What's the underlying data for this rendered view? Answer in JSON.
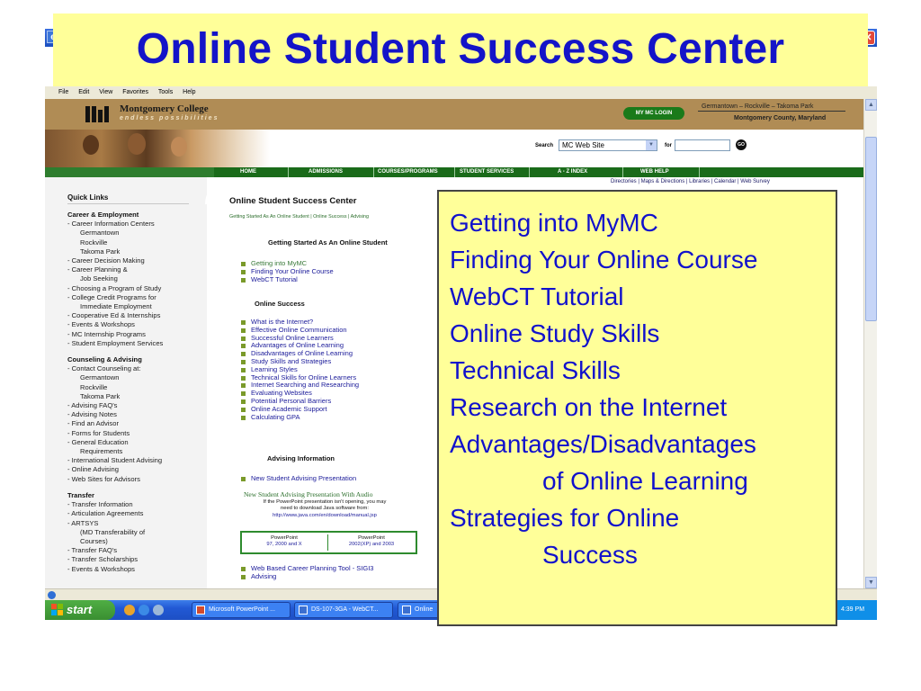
{
  "slide_title": "Online Student Success Center",
  "browser": {
    "menu": [
      "File",
      "Edit",
      "View",
      "Favorites",
      "Tools",
      "Help"
    ]
  },
  "college": {
    "name": "Montgomery College",
    "tagline": "endless possibilities",
    "my_mc_login": "MY MC LOGIN",
    "campuses": "Germantown – Rockville – Takoma Park",
    "county": "Montgomery County, Maryland",
    "search_label": "Search",
    "search_scope": "MC Web Site",
    "for_label": "for",
    "go_label": "GO"
  },
  "nav": [
    "HOME",
    "ADMISSIONS",
    "COURSES/PROGRAMS",
    "STUDENT SERVICES",
    "A - Z INDEX",
    "WEB HELP"
  ],
  "utility_links": "Directories | Maps & Directions | Libraries | Calendar | Web Survey",
  "sidebar": {
    "quick_links": "Quick Links",
    "items": [
      {
        "text": "Career & Employment",
        "type": "h"
      },
      {
        "text": "- Career Information Centers",
        "type": "n"
      },
      {
        "text": "Germantown",
        "type": "i"
      },
      {
        "text": "Rockville",
        "type": "i"
      },
      {
        "text": "Takoma Park",
        "type": "i"
      },
      {
        "text": "- Career Decision Making",
        "type": "n"
      },
      {
        "text": "- Career Planning &",
        "type": "n"
      },
      {
        "text": "Job Seeking",
        "type": "i"
      },
      {
        "text": "- Choosing a Program of Study",
        "type": "n"
      },
      {
        "text": "- College Credit Programs for",
        "type": "n"
      },
      {
        "text": "Immediate Employment",
        "type": "i"
      },
      {
        "text": "- Cooperative Ed & Internships",
        "type": "n"
      },
      {
        "text": "- Events & Workshops",
        "type": "n"
      },
      {
        "text": "- MC Internship Programs",
        "type": "n"
      },
      {
        "text": "- Student Employment Services",
        "type": "n"
      },
      {
        "text": "",
        "type": "gap"
      },
      {
        "text": "Counseling & Advising",
        "type": "h"
      },
      {
        "text": "- Contact Counseling at:",
        "type": "n"
      },
      {
        "text": "Germantown",
        "type": "i"
      },
      {
        "text": "Rockville",
        "type": "i"
      },
      {
        "text": "Takoma Park",
        "type": "i"
      },
      {
        "text": "- Advising FAQ's",
        "type": "n"
      },
      {
        "text": "- Advising Notes",
        "type": "n"
      },
      {
        "text": "- Find an Advisor",
        "type": "n"
      },
      {
        "text": "- Forms for Students",
        "type": "n"
      },
      {
        "text": "- General Education",
        "type": "n"
      },
      {
        "text": "Requirements",
        "type": "i"
      },
      {
        "text": "- International Student Advising",
        "type": "n"
      },
      {
        "text": "- Online Advising",
        "type": "n"
      },
      {
        "text": "- Web Sites for Advisors",
        "type": "n"
      },
      {
        "text": "",
        "type": "gap"
      },
      {
        "text": "Transfer",
        "type": "h"
      },
      {
        "text": "- Transfer Information",
        "type": "n"
      },
      {
        "text": "- Articulation Agreements",
        "type": "n"
      },
      {
        "text": "- ARTSYS",
        "type": "n"
      },
      {
        "text": "(MD Transferability of",
        "type": "i"
      },
      {
        "text": "Courses)",
        "type": "i"
      },
      {
        "text": "- Transfer FAQ's",
        "type": "n"
      },
      {
        "text": "- Transfer Scholarships",
        "type": "n"
      },
      {
        "text": "- Events & Workshops",
        "type": "n"
      }
    ]
  },
  "center": {
    "title": "Online Student Success Center",
    "crumb": "Getting Started As An Online Student | Online Success | Advising",
    "section1": "Getting Started As An Online Student",
    "list1": [
      "Getting into MyMC",
      "Finding Your Online Course",
      "WebCT Tutorial"
    ],
    "section2": "Online Success",
    "list2": [
      "What is the Internet?",
      "Effective Online Communication",
      "Successful Online Learners",
      "Advantages of Online Learning",
      "Disadvantages of Online Learning",
      "Study Skills and Strategies",
      "Learning Styles",
      "Technical Skills for Online Learners",
      "Internet Searching and Researching",
      "Evaluating Websites",
      "Potential Personal Barriers",
      "Online Academic Support",
      "Calculating GPA"
    ],
    "section3": "Advising Information",
    "list3": [
      "New Student Advising Presentation"
    ],
    "nsa_title": "New Student Advising Presentation With Audio",
    "nsa_line1": "If the PowerPoint presentation isn't opening, you may",
    "nsa_line2": "need to download Java software from:",
    "nsa_url": "http://www.java.com/en/download/manual.jsp",
    "nsa_cell1_a": "PowerPoint",
    "nsa_cell1_b": "97, 2000 and X",
    "nsa_cell2_a": "PowerPoint",
    "nsa_cell2_b": "2002(XP) and 2003",
    "list4": [
      "Web Based Career Planning Tool - SIGI3",
      "Advising"
    ]
  },
  "taskbar": {
    "start": "start",
    "buttons": [
      "Microsoft PowerPoint ...",
      "DS-107-3GA - WebCT...",
      "Online"
    ],
    "clock": "4:39 PM"
  },
  "overlay_list": [
    {
      "text": "Getting into MyMC",
      "cont": false
    },
    {
      "text": "Finding Your Online Course",
      "cont": false
    },
    {
      "text": "WebCT Tutorial",
      "cont": false
    },
    {
      "text": "Online Study Skills",
      "cont": false
    },
    {
      "text": "Technical Skills",
      "cont": false
    },
    {
      "text": "Research on the Internet",
      "cont": false
    },
    {
      "text": "Advantages/Disadvantages",
      "cont": false
    },
    {
      "text": "of Online Learning",
      "cont": true
    },
    {
      "text": "Strategies for Online",
      "cont": false
    },
    {
      "text": "Success",
      "cont": true
    }
  ],
  "colors": {
    "title_blue": "#1414c8",
    "overlay_yellow": "#ffff99",
    "mc_brown": "#b08c55",
    "nav_green": "#1a6b1a",
    "taskbar_blue": "#2259d4"
  }
}
